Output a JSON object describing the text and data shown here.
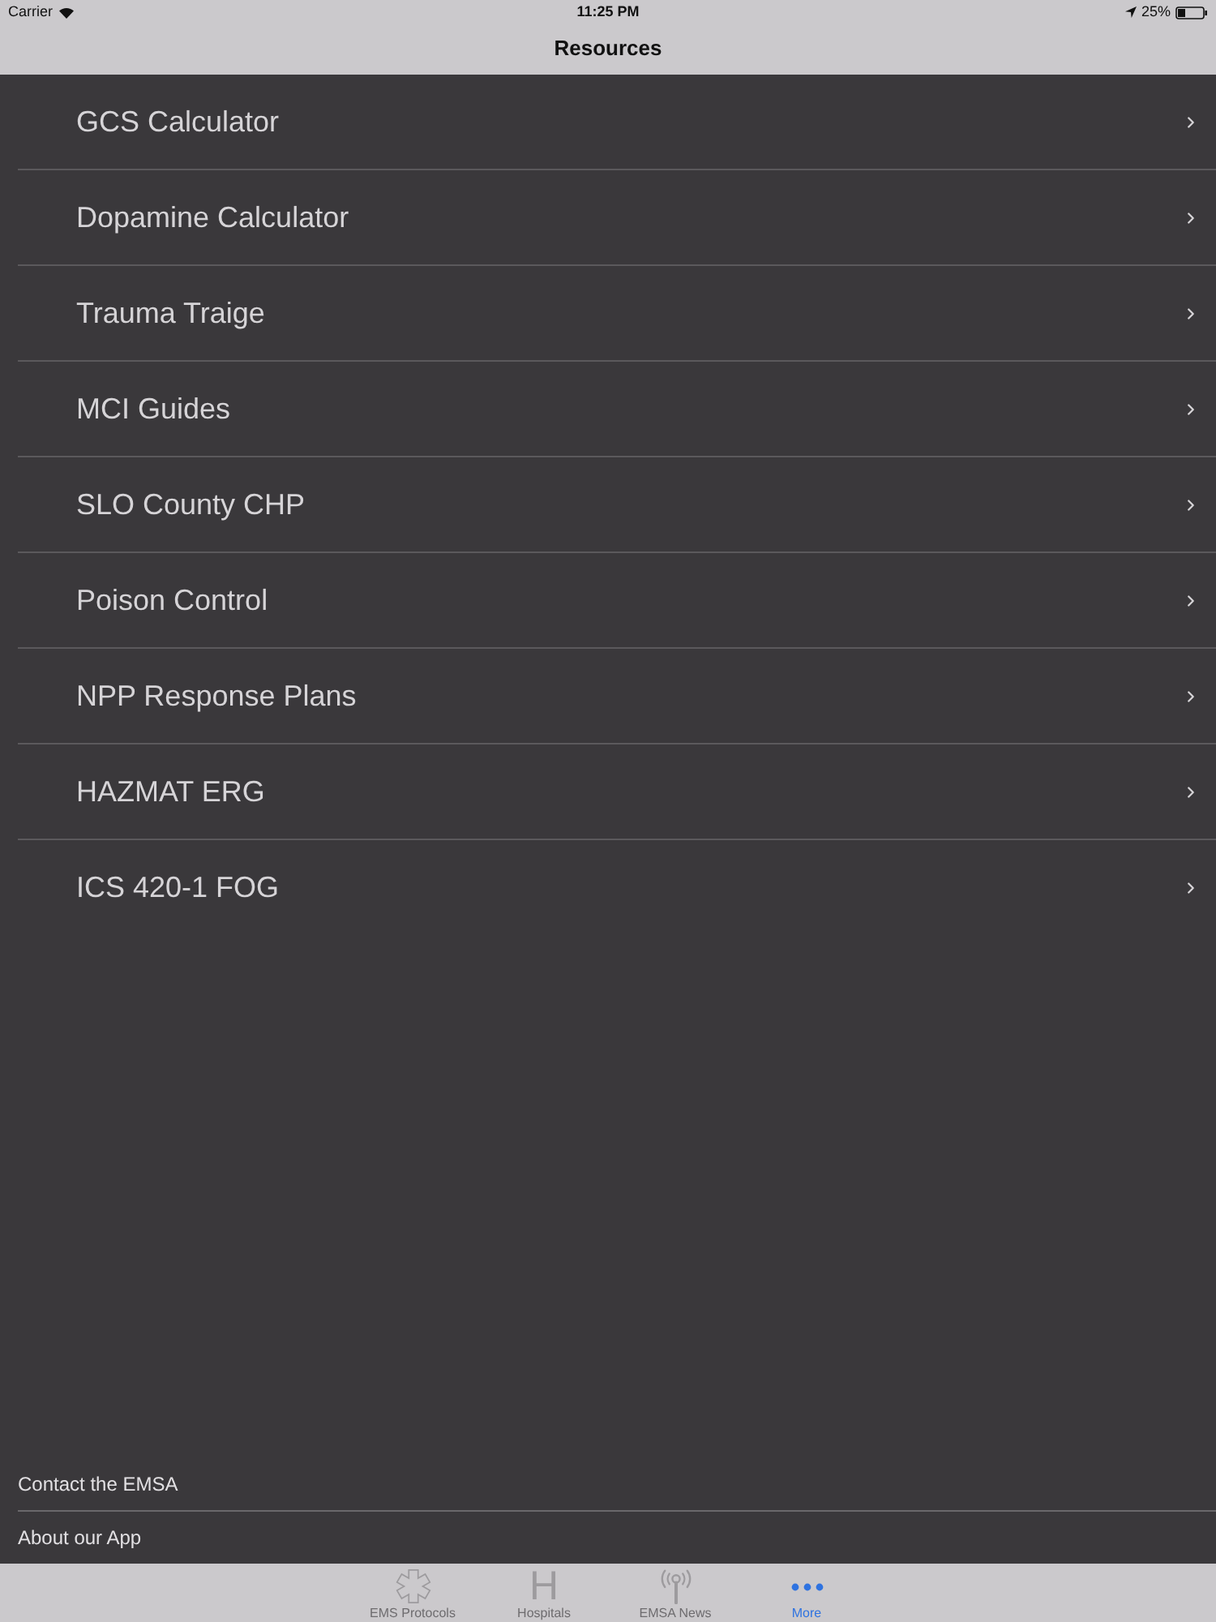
{
  "status_bar": {
    "carrier": "Carrier",
    "time": "11:25 PM",
    "battery": "25%"
  },
  "nav_bar": {
    "title": "Resources"
  },
  "resources": [
    "GCS Calculator",
    "Dopamine Calculator",
    "Trauma Traige",
    "MCI Guides",
    "SLO County CHP",
    "Poison Control",
    "NPP Response Plans",
    "HAZMAT ERG",
    "ICS 420-1 FOG"
  ],
  "footer_links": [
    "Contact the EMSA",
    "About our App"
  ],
  "tab_bar": [
    {
      "kind": "star",
      "label": "EMS Protocols",
      "selected": false
    },
    {
      "kind": "letter",
      "glyph": "H",
      "label": "Hospitals",
      "selected": false
    },
    {
      "kind": "antenna",
      "label": "EMSA News",
      "selected": false
    },
    {
      "kind": "dots",
      "label": "More",
      "selected": true
    }
  ]
}
